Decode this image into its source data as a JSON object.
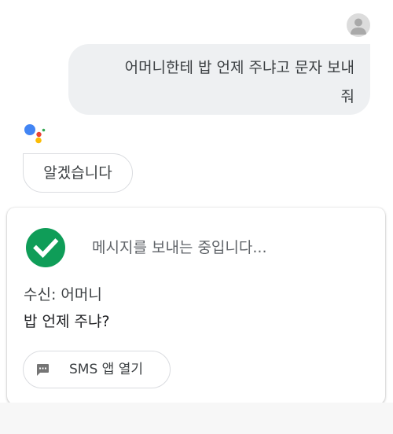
{
  "conversation": {
    "user_message_line1": "어머니한테 밥 언제 주냐고 문자 보내",
    "user_message_line2": "줘",
    "assistant_reply": "알겠습니다"
  },
  "sms_card": {
    "status": "메시지를 보내는 중입니다...",
    "recipient": "수신: 어머니",
    "message": "밥 언제 주냐?",
    "open_button_label": "SMS 앱 열기",
    "open_button_icon": "message-icon",
    "status_icon": "check-circle-icon"
  },
  "colors": {
    "user_bubble": "#eef0f2",
    "check_green": "#0f9d58",
    "assistant_blue": "#4285f4",
    "assistant_red": "#ea4335",
    "assistant_yellow": "#fbbc05",
    "assistant_green": "#34a853"
  }
}
